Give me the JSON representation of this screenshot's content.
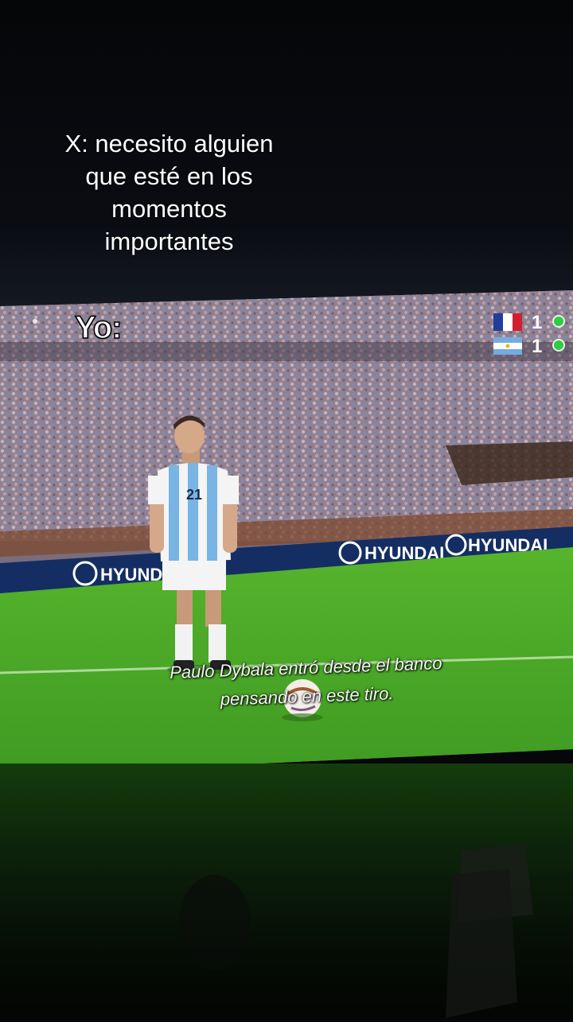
{
  "caption": {
    "lines": [
      "X: necesito alguien",
      "que esté en los",
      "momentos",
      "importantes"
    ]
  },
  "tv_overlay": {
    "label": "Yo:"
  },
  "scoreboard": {
    "rows": [
      {
        "team_flag": "france-flag-icon",
        "score": "1"
      },
      {
        "team_flag": "argentina-flag-icon",
        "score": "1"
      }
    ]
  },
  "subtitle": {
    "lines": [
      "Paulo Dybala entró desde el banco",
      "pensando en este tiro."
    ]
  },
  "player": {
    "number": "21"
  },
  "ad_boards": {
    "brand": "HYUNDAI"
  },
  "colors": {
    "pitch": "#4fae2a",
    "crowd": "#9a8c9a",
    "argentina_blue": "#78b4e4",
    "ad_board": "#123060"
  }
}
